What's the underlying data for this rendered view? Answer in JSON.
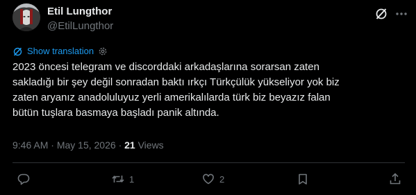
{
  "author": {
    "name": "Etil Lungthor",
    "handle": "@EtilLungthor"
  },
  "translate": {
    "label": "Show translation"
  },
  "tweet": {
    "lines": [
      "2023 öncesi telegram ve discorddaki arkadaşlarına sorarsan zaten",
      "sakladığı bir şey değil sonradan baktı ırkçı Türkçülük yükseliyor yok biz",
      "zaten aryanız anadoluluyuz yerli amerikalılarda türk biz beyazız falan",
      "bütün tuşlara basmaya başladı panik altında."
    ]
  },
  "meta": {
    "time": "9:46 AM",
    "separator1": "·",
    "date": "May 15, 2026",
    "separator2": "·",
    "views_count": "21",
    "views_label": "Views"
  },
  "actions": {
    "reply_count": "",
    "retweet_count": "1",
    "like_count": "2"
  },
  "icons": {
    "grok": "grok-icon",
    "more": "more-icon",
    "translate": "translate-icon",
    "settings": "settings-icon",
    "reply": "reply-icon",
    "retweet": "retweet-icon",
    "like": "heart-icon",
    "bookmark": "bookmark-icon",
    "share": "share-icon"
  },
  "colors": {
    "background": "#000000",
    "text": "#e7e9ea",
    "secondary": "#71767b",
    "accent": "#1d9bf0",
    "divider": "#2f3336"
  }
}
